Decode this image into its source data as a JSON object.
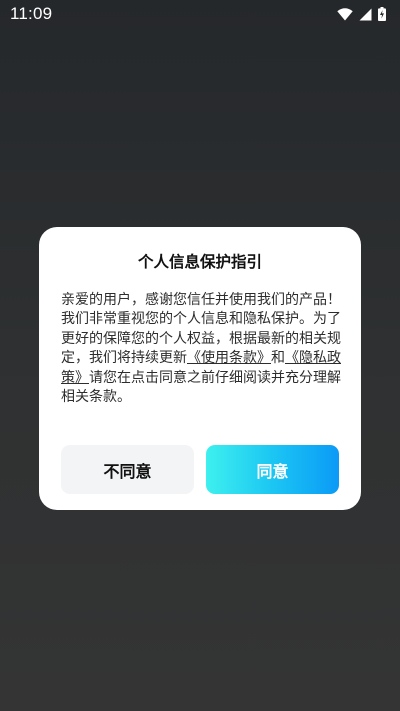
{
  "status_bar": {
    "time": "11:09",
    "icons": [
      "wifi-icon",
      "signal-icon",
      "battery-charging-icon"
    ]
  },
  "dialog": {
    "title": "个人信息保护指引",
    "body_intro": "亲爱的用户，感谢您信任并使用我们的产品！我们非常重视您的个人信息和隐私保护。为了更好的保障您的个人权益，根据最新的相关规定，我们将持续更新",
    "link_terms": "《使用条款》",
    "connector": "和",
    "link_privacy": "《隐私政策》",
    "body_outro": "请您在点击同意之前仔细阅读并充分理解相关条款。",
    "decline_label": "不同意",
    "agree_label": "同意"
  },
  "colors": {
    "background_top": "#25282b",
    "background_bottom": "#343434",
    "agree_gradient_start": "#3ef0ee",
    "agree_gradient_end": "#0b9af7",
    "decline_bg": "#f3f4f6"
  }
}
